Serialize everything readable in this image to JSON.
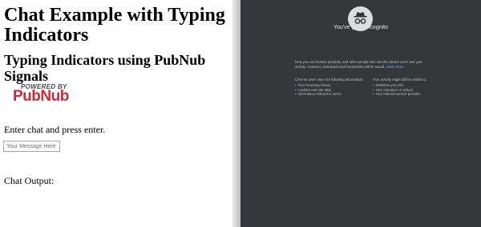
{
  "page": {
    "title": "Chat Example with Typing Indicators",
    "subtitle": "Typing Indicators using PubNub Signals",
    "logo": {
      "powered_by": "POWERED BY",
      "brand": "PubNub"
    },
    "prompt": "Enter chat and press enter.",
    "message_input": {
      "placeholder": "Your Message Here",
      "value": ""
    },
    "chat_output_label": "Chat Output:"
  },
  "incognito": {
    "icon": "incognito-icon",
    "title": "You've gone incognito",
    "description": "Now you can browse privately, and other people who use this device won't see your activity. However, downloads and bookmarks will be saved.",
    "learn_more": "Learn more",
    "not_saved": {
      "heading": "Chrome won't save the following information:",
      "items": [
        "Your browsing history",
        "Cookies and site data",
        "Information entered in forms"
      ]
    },
    "visible_to": {
      "heading": "Your activity might still be visible to:",
      "items": [
        "Websites you visit",
        "Your employer or school",
        "Your internet service provider"
      ]
    }
  },
  "colors": {
    "pubnub_red": "#ca2c38",
    "incognito_bg": "#35363a",
    "link": "#8ab4f8"
  }
}
